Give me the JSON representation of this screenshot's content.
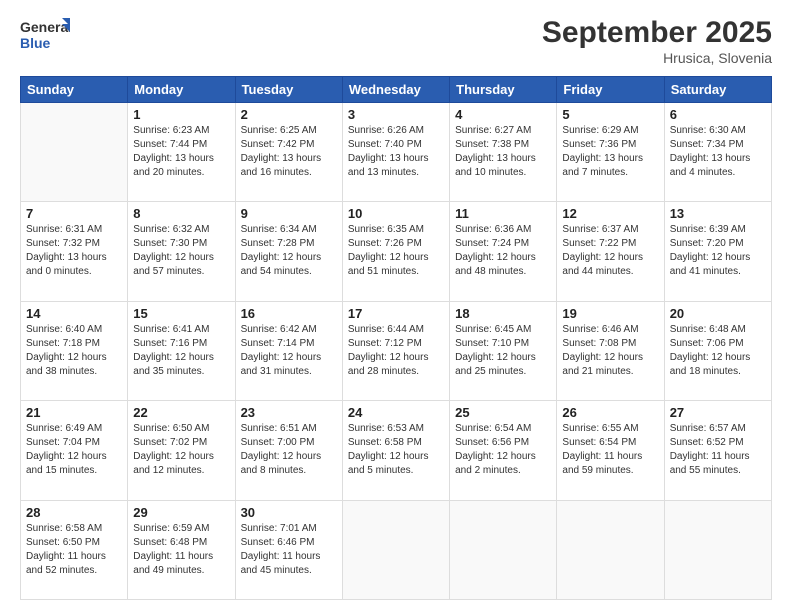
{
  "logo": {
    "line1": "General",
    "line2": "Blue"
  },
  "title": "September 2025",
  "location": "Hrusica, Slovenia",
  "days_header": [
    "Sunday",
    "Monday",
    "Tuesday",
    "Wednesday",
    "Thursday",
    "Friday",
    "Saturday"
  ],
  "weeks": [
    [
      {
        "day": "",
        "info": ""
      },
      {
        "day": "1",
        "info": "Sunrise: 6:23 AM\nSunset: 7:44 PM\nDaylight: 13 hours\nand 20 minutes."
      },
      {
        "day": "2",
        "info": "Sunrise: 6:25 AM\nSunset: 7:42 PM\nDaylight: 13 hours\nand 16 minutes."
      },
      {
        "day": "3",
        "info": "Sunrise: 6:26 AM\nSunset: 7:40 PM\nDaylight: 13 hours\nand 13 minutes."
      },
      {
        "day": "4",
        "info": "Sunrise: 6:27 AM\nSunset: 7:38 PM\nDaylight: 13 hours\nand 10 minutes."
      },
      {
        "day": "5",
        "info": "Sunrise: 6:29 AM\nSunset: 7:36 PM\nDaylight: 13 hours\nand 7 minutes."
      },
      {
        "day": "6",
        "info": "Sunrise: 6:30 AM\nSunset: 7:34 PM\nDaylight: 13 hours\nand 4 minutes."
      }
    ],
    [
      {
        "day": "7",
        "info": "Sunrise: 6:31 AM\nSunset: 7:32 PM\nDaylight: 13 hours\nand 0 minutes."
      },
      {
        "day": "8",
        "info": "Sunrise: 6:32 AM\nSunset: 7:30 PM\nDaylight: 12 hours\nand 57 minutes."
      },
      {
        "day": "9",
        "info": "Sunrise: 6:34 AM\nSunset: 7:28 PM\nDaylight: 12 hours\nand 54 minutes."
      },
      {
        "day": "10",
        "info": "Sunrise: 6:35 AM\nSunset: 7:26 PM\nDaylight: 12 hours\nand 51 minutes."
      },
      {
        "day": "11",
        "info": "Sunrise: 6:36 AM\nSunset: 7:24 PM\nDaylight: 12 hours\nand 48 minutes."
      },
      {
        "day": "12",
        "info": "Sunrise: 6:37 AM\nSunset: 7:22 PM\nDaylight: 12 hours\nand 44 minutes."
      },
      {
        "day": "13",
        "info": "Sunrise: 6:39 AM\nSunset: 7:20 PM\nDaylight: 12 hours\nand 41 minutes."
      }
    ],
    [
      {
        "day": "14",
        "info": "Sunrise: 6:40 AM\nSunset: 7:18 PM\nDaylight: 12 hours\nand 38 minutes."
      },
      {
        "day": "15",
        "info": "Sunrise: 6:41 AM\nSunset: 7:16 PM\nDaylight: 12 hours\nand 35 minutes."
      },
      {
        "day": "16",
        "info": "Sunrise: 6:42 AM\nSunset: 7:14 PM\nDaylight: 12 hours\nand 31 minutes."
      },
      {
        "day": "17",
        "info": "Sunrise: 6:44 AM\nSunset: 7:12 PM\nDaylight: 12 hours\nand 28 minutes."
      },
      {
        "day": "18",
        "info": "Sunrise: 6:45 AM\nSunset: 7:10 PM\nDaylight: 12 hours\nand 25 minutes."
      },
      {
        "day": "19",
        "info": "Sunrise: 6:46 AM\nSunset: 7:08 PM\nDaylight: 12 hours\nand 21 minutes."
      },
      {
        "day": "20",
        "info": "Sunrise: 6:48 AM\nSunset: 7:06 PM\nDaylight: 12 hours\nand 18 minutes."
      }
    ],
    [
      {
        "day": "21",
        "info": "Sunrise: 6:49 AM\nSunset: 7:04 PM\nDaylight: 12 hours\nand 15 minutes."
      },
      {
        "day": "22",
        "info": "Sunrise: 6:50 AM\nSunset: 7:02 PM\nDaylight: 12 hours\nand 12 minutes."
      },
      {
        "day": "23",
        "info": "Sunrise: 6:51 AM\nSunset: 7:00 PM\nDaylight: 12 hours\nand 8 minutes."
      },
      {
        "day": "24",
        "info": "Sunrise: 6:53 AM\nSunset: 6:58 PM\nDaylight: 12 hours\nand 5 minutes."
      },
      {
        "day": "25",
        "info": "Sunrise: 6:54 AM\nSunset: 6:56 PM\nDaylight: 12 hours\nand 2 minutes."
      },
      {
        "day": "26",
        "info": "Sunrise: 6:55 AM\nSunset: 6:54 PM\nDaylight: 11 hours\nand 59 minutes."
      },
      {
        "day": "27",
        "info": "Sunrise: 6:57 AM\nSunset: 6:52 PM\nDaylight: 11 hours\nand 55 minutes."
      }
    ],
    [
      {
        "day": "28",
        "info": "Sunrise: 6:58 AM\nSunset: 6:50 PM\nDaylight: 11 hours\nand 52 minutes."
      },
      {
        "day": "29",
        "info": "Sunrise: 6:59 AM\nSunset: 6:48 PM\nDaylight: 11 hours\nand 49 minutes."
      },
      {
        "day": "30",
        "info": "Sunrise: 7:01 AM\nSunset: 6:46 PM\nDaylight: 11 hours\nand 45 minutes."
      },
      {
        "day": "",
        "info": ""
      },
      {
        "day": "",
        "info": ""
      },
      {
        "day": "",
        "info": ""
      },
      {
        "day": "",
        "info": ""
      }
    ]
  ]
}
